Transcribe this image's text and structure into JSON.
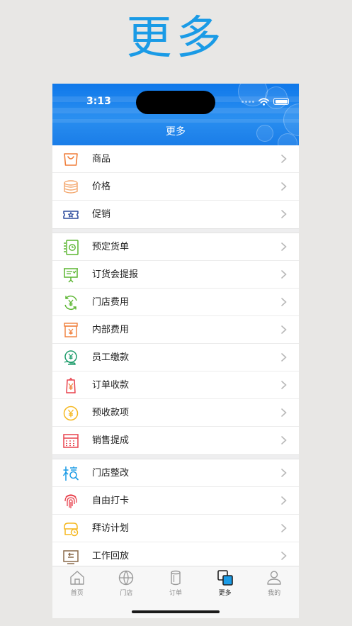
{
  "banner": {
    "title": "更多"
  },
  "status_bar": {
    "time": "3:13"
  },
  "header": {
    "title": "更多"
  },
  "groups": [
    {
      "items": [
        {
          "label": "商品",
          "icon": "shopping-bag-icon"
        },
        {
          "label": "价格",
          "icon": "coin-stack-icon"
        },
        {
          "label": "促销",
          "icon": "ticket-star-icon"
        }
      ]
    },
    {
      "items": [
        {
          "label": "预定货单",
          "icon": "schedule-order-icon"
        },
        {
          "label": "订货会提报",
          "icon": "presentation-board-icon"
        },
        {
          "label": "门店费用",
          "icon": "yen-cycle-icon"
        },
        {
          "label": "内部费用",
          "icon": "yen-box-icon"
        },
        {
          "label": "员工缴款",
          "icon": "yen-hand-icon"
        },
        {
          "label": "订单收款",
          "icon": "yen-tag-icon"
        },
        {
          "label": "预收款项",
          "icon": "yen-coin-icon"
        },
        {
          "label": "销售提成",
          "icon": "calculator-icon"
        }
      ]
    },
    {
      "items": [
        {
          "label": "门店整改",
          "icon": "inspect-icon"
        },
        {
          "label": "自由打卡",
          "icon": "fingerprint-icon"
        },
        {
          "label": "拜访计划",
          "icon": "visit-plan-icon"
        },
        {
          "label": "工作回放",
          "icon": "replay-icon"
        }
      ]
    }
  ],
  "tabs": [
    {
      "label": "首页",
      "icon": "home-icon",
      "active": false
    },
    {
      "label": "门店",
      "icon": "globe-icon",
      "active": false
    },
    {
      "label": "订单",
      "icon": "order-cylinder-icon",
      "active": false
    },
    {
      "label": "更多",
      "icon": "more-squares-icon",
      "active": true
    },
    {
      "label": "我的",
      "icon": "person-icon",
      "active": false
    }
  ],
  "colors": {
    "brand_blue": "#1a9be6",
    "header_blue": "#1a7de8",
    "orange": "#f07f3c",
    "green": "#5bb531",
    "teal": "#1d9c6b",
    "yellow": "#f5b820",
    "red": "#e8424d",
    "navy": "#2b4a9c",
    "brown": "#8a6a4a"
  }
}
